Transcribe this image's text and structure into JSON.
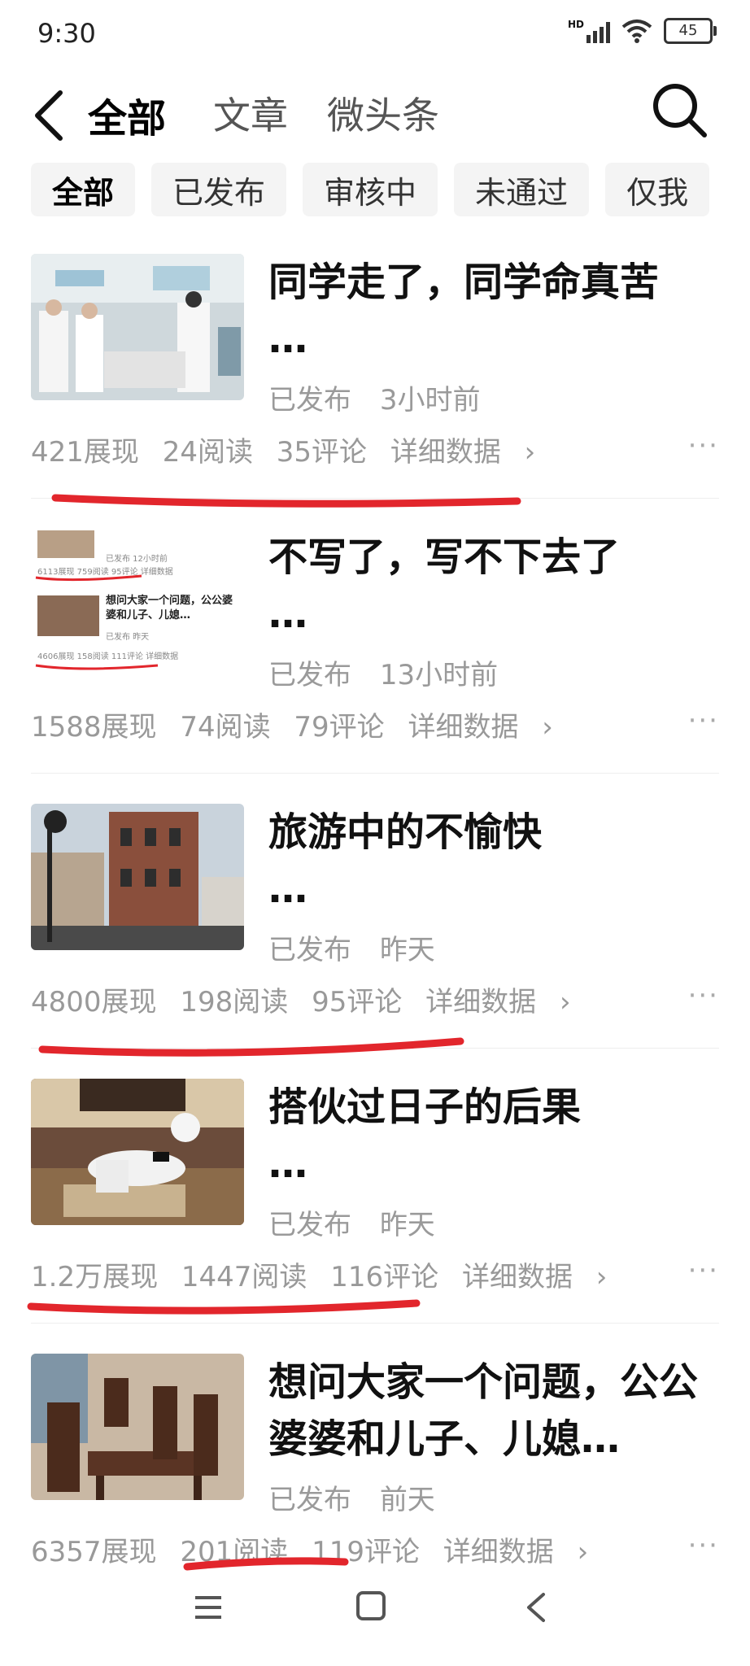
{
  "status": {
    "time": "9:30",
    "signal_label": "HD",
    "battery": "45"
  },
  "header": {
    "tabs": [
      {
        "label": "全部"
      },
      {
        "label": "文章"
      },
      {
        "label": "微头条"
      }
    ]
  },
  "filters": [
    "全部",
    "已发布",
    "审核中",
    "未通过",
    "仅我"
  ],
  "articles": [
    {
      "title": "同学走了，同学命真苦",
      "ellipsis": "…",
      "status": "已发布",
      "time": "3小时前",
      "impressions": "421展现",
      "reads": "24阅读",
      "comments": "35评论",
      "detail": "详细数据",
      "thumb": "hospital-photo"
    },
    {
      "title": "不写了，写不下去了",
      "ellipsis": "…",
      "status": "已发布",
      "time": "13小时前",
      "impressions": "1588展现",
      "reads": "74阅读",
      "comments": "79评论",
      "detail": "详细数据",
      "thumb": "screenshot-collage",
      "thumb_text": {
        "row1_meta": "已发布  12小时前",
        "row1_stats": "6113展现  759阅读  95评论  详细数据",
        "row2_title": "想问大家一个问题，公公婆婆和儿子、儿媳…",
        "row2_meta": "已发布  昨天",
        "row2_stats": "4606展现  158阅读  111评论  详细数据"
      }
    },
    {
      "title": "旅游中的不愉快",
      "ellipsis": "…",
      "status": "已发布",
      "time": "昨天",
      "impressions": "4800展现",
      "reads": "198阅读",
      "comments": "95评论",
      "detail": "详细数据",
      "thumb": "street-building-photo"
    },
    {
      "title": "搭伙过日子的后果",
      "ellipsis": "…",
      "status": "已发布",
      "time": "昨天",
      "impressions": "1.2万展现",
      "reads": "1447阅读",
      "comments": "116评论",
      "detail": "详细数据",
      "thumb": "kneeling-mourner-photo"
    },
    {
      "title": "想问大家一个问题，公公婆婆和儿子、儿媳…",
      "ellipsis": "",
      "status": "已发布",
      "time": "前天",
      "impressions": "6357展现",
      "reads": "201阅读",
      "comments": "119评论",
      "detail": "详细数据",
      "thumb": "dining-room-photo"
    }
  ],
  "colors": {
    "accent_underline": "#e2262c",
    "muted_text": "#999999",
    "chip_bg": "#f4f4f4"
  },
  "icons": [
    "back-arrow-icon",
    "search-icon",
    "chevron-right-icon",
    "more-dots-icon",
    "menu-icon",
    "home-square-icon",
    "nav-back-icon"
  ]
}
